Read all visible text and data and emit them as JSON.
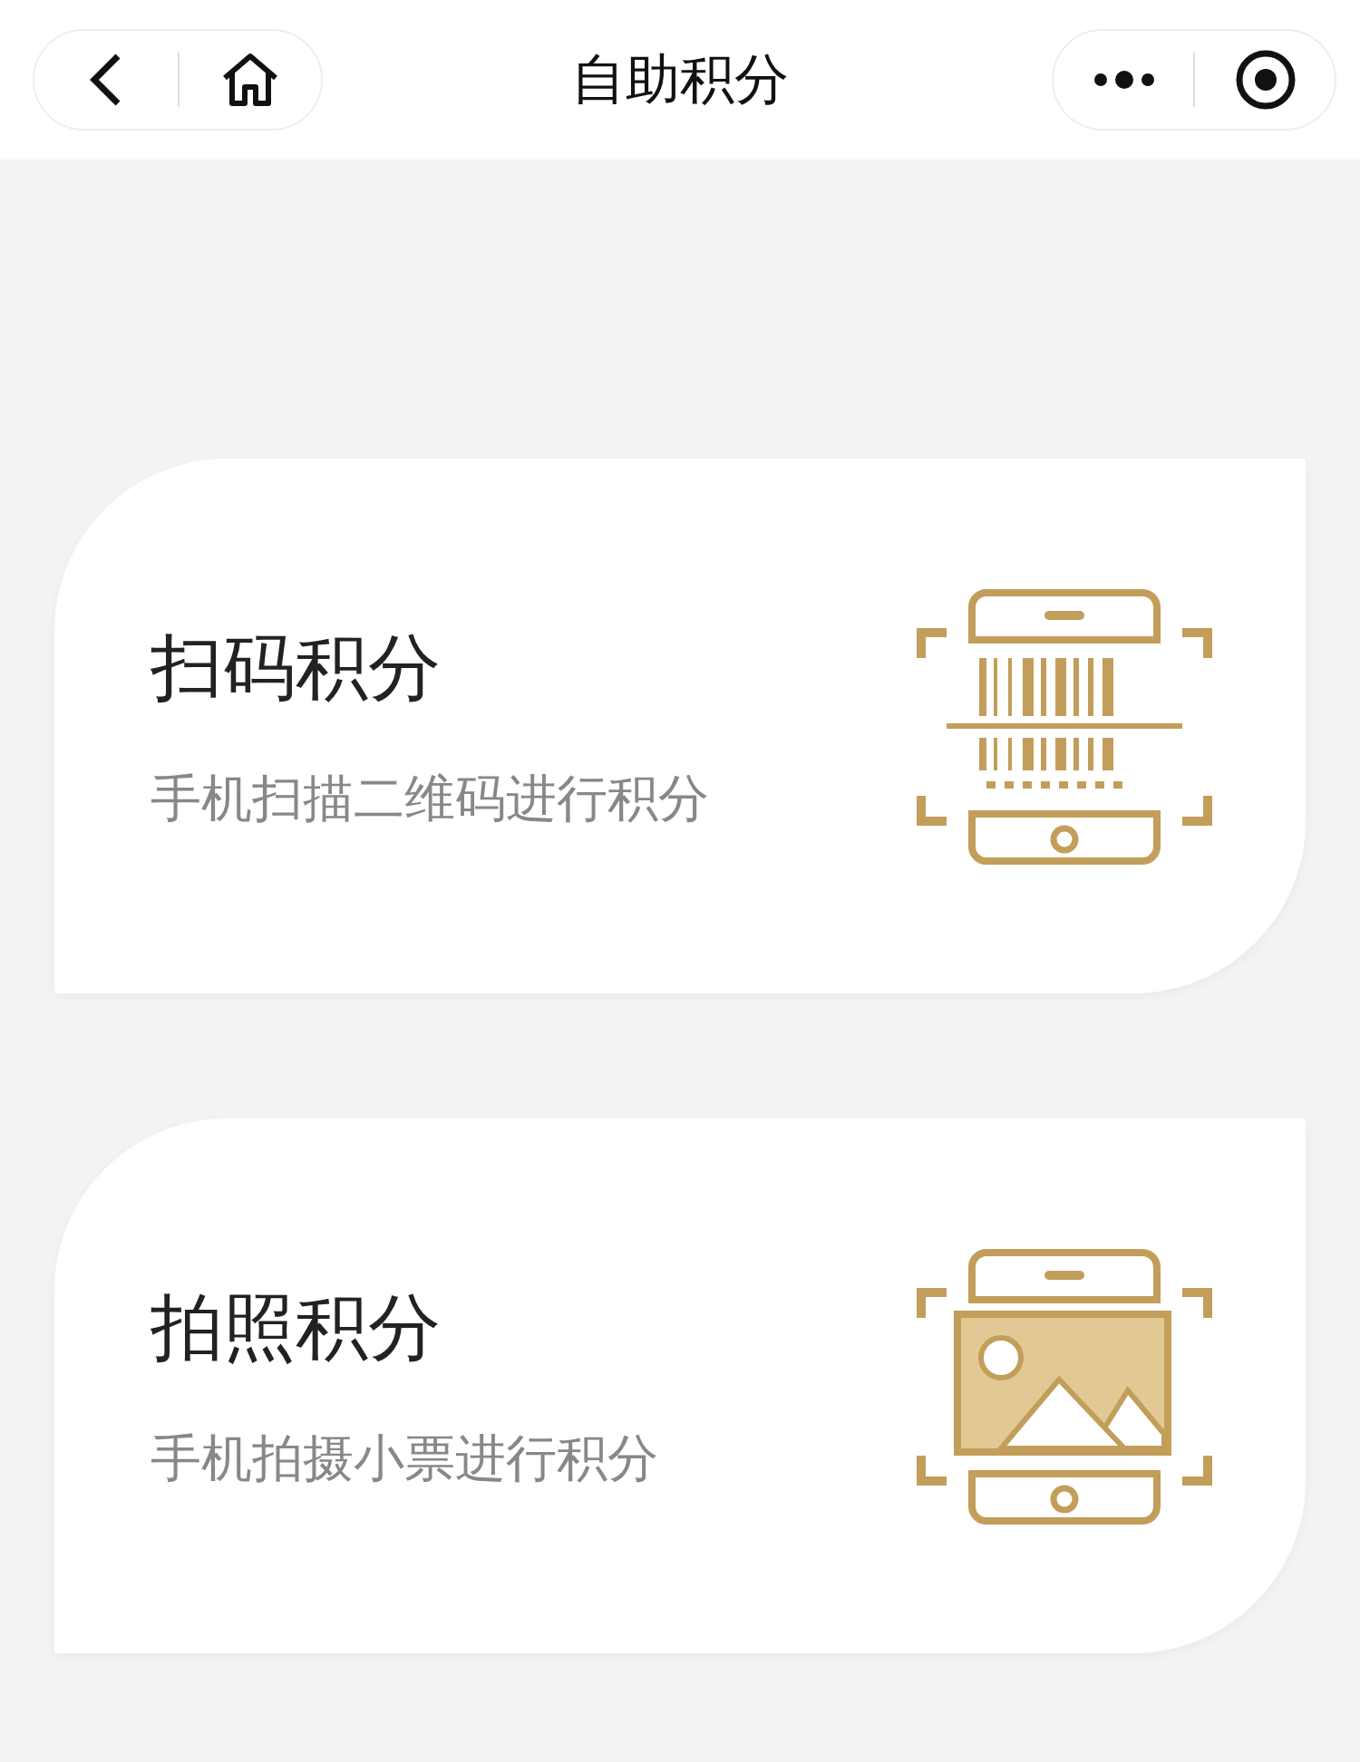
{
  "nav_bar": {
    "title": "自助积分"
  },
  "cards": [
    {
      "kind": "barcode",
      "title": "扫码积分",
      "subtitle": "手机扫描二维码进行积分"
    },
    {
      "kind": "photo",
      "title": "拍照积分",
      "subtitle": "手机拍摄小票进行积分"
    }
  ]
}
